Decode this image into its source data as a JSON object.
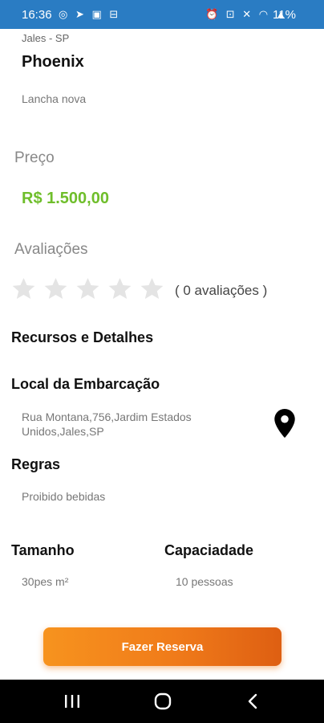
{
  "status_bar": {
    "time": "16:36",
    "left_icons": [
      "whatsapp-icon",
      "telegram-icon",
      "gallery-icon",
      "app-icon"
    ],
    "left_icons_text": "◎ ➤ ▣ ⊟",
    "right_icons": [
      "alarm-icon",
      "nfc-icon",
      "mute-icon",
      "wifi-icon",
      "signal-icon"
    ],
    "right_icons_text": "⏰ ⊡ ✕ ◠ ▲",
    "battery": "11%",
    "background": "#2a7cc3"
  },
  "boat": {
    "location": "Jales - SP",
    "name": "Phoenix",
    "description": "Lancha nova"
  },
  "price": {
    "label": "Preço",
    "value": "R$ 1.500,00",
    "color": "#6fbe2b"
  },
  "reviews": {
    "label": "Avaliações",
    "rating": 0,
    "max_stars": 5,
    "count_text": "( 0 avaliações )"
  },
  "features": {
    "title": "Recursos e Detalhes"
  },
  "boat_location": {
    "title": "Local da Embarcação",
    "address": "Rua Montana,756,Jardim Estados Unidos,Jales,SP",
    "icon": "location-pin-icon"
  },
  "rules": {
    "title": "Regras",
    "text": "Proibido bebidas"
  },
  "size": {
    "title": "Tamanho",
    "value": "30pes m²"
  },
  "capacity": {
    "title": "Capaciadade",
    "value": "10 pessoas"
  },
  "reserve_button": {
    "label": "Fazer Reserva",
    "color": "#f07b1a"
  },
  "nav_bar": {
    "buttons": [
      "recents-icon",
      "home-icon",
      "back-icon"
    ]
  }
}
